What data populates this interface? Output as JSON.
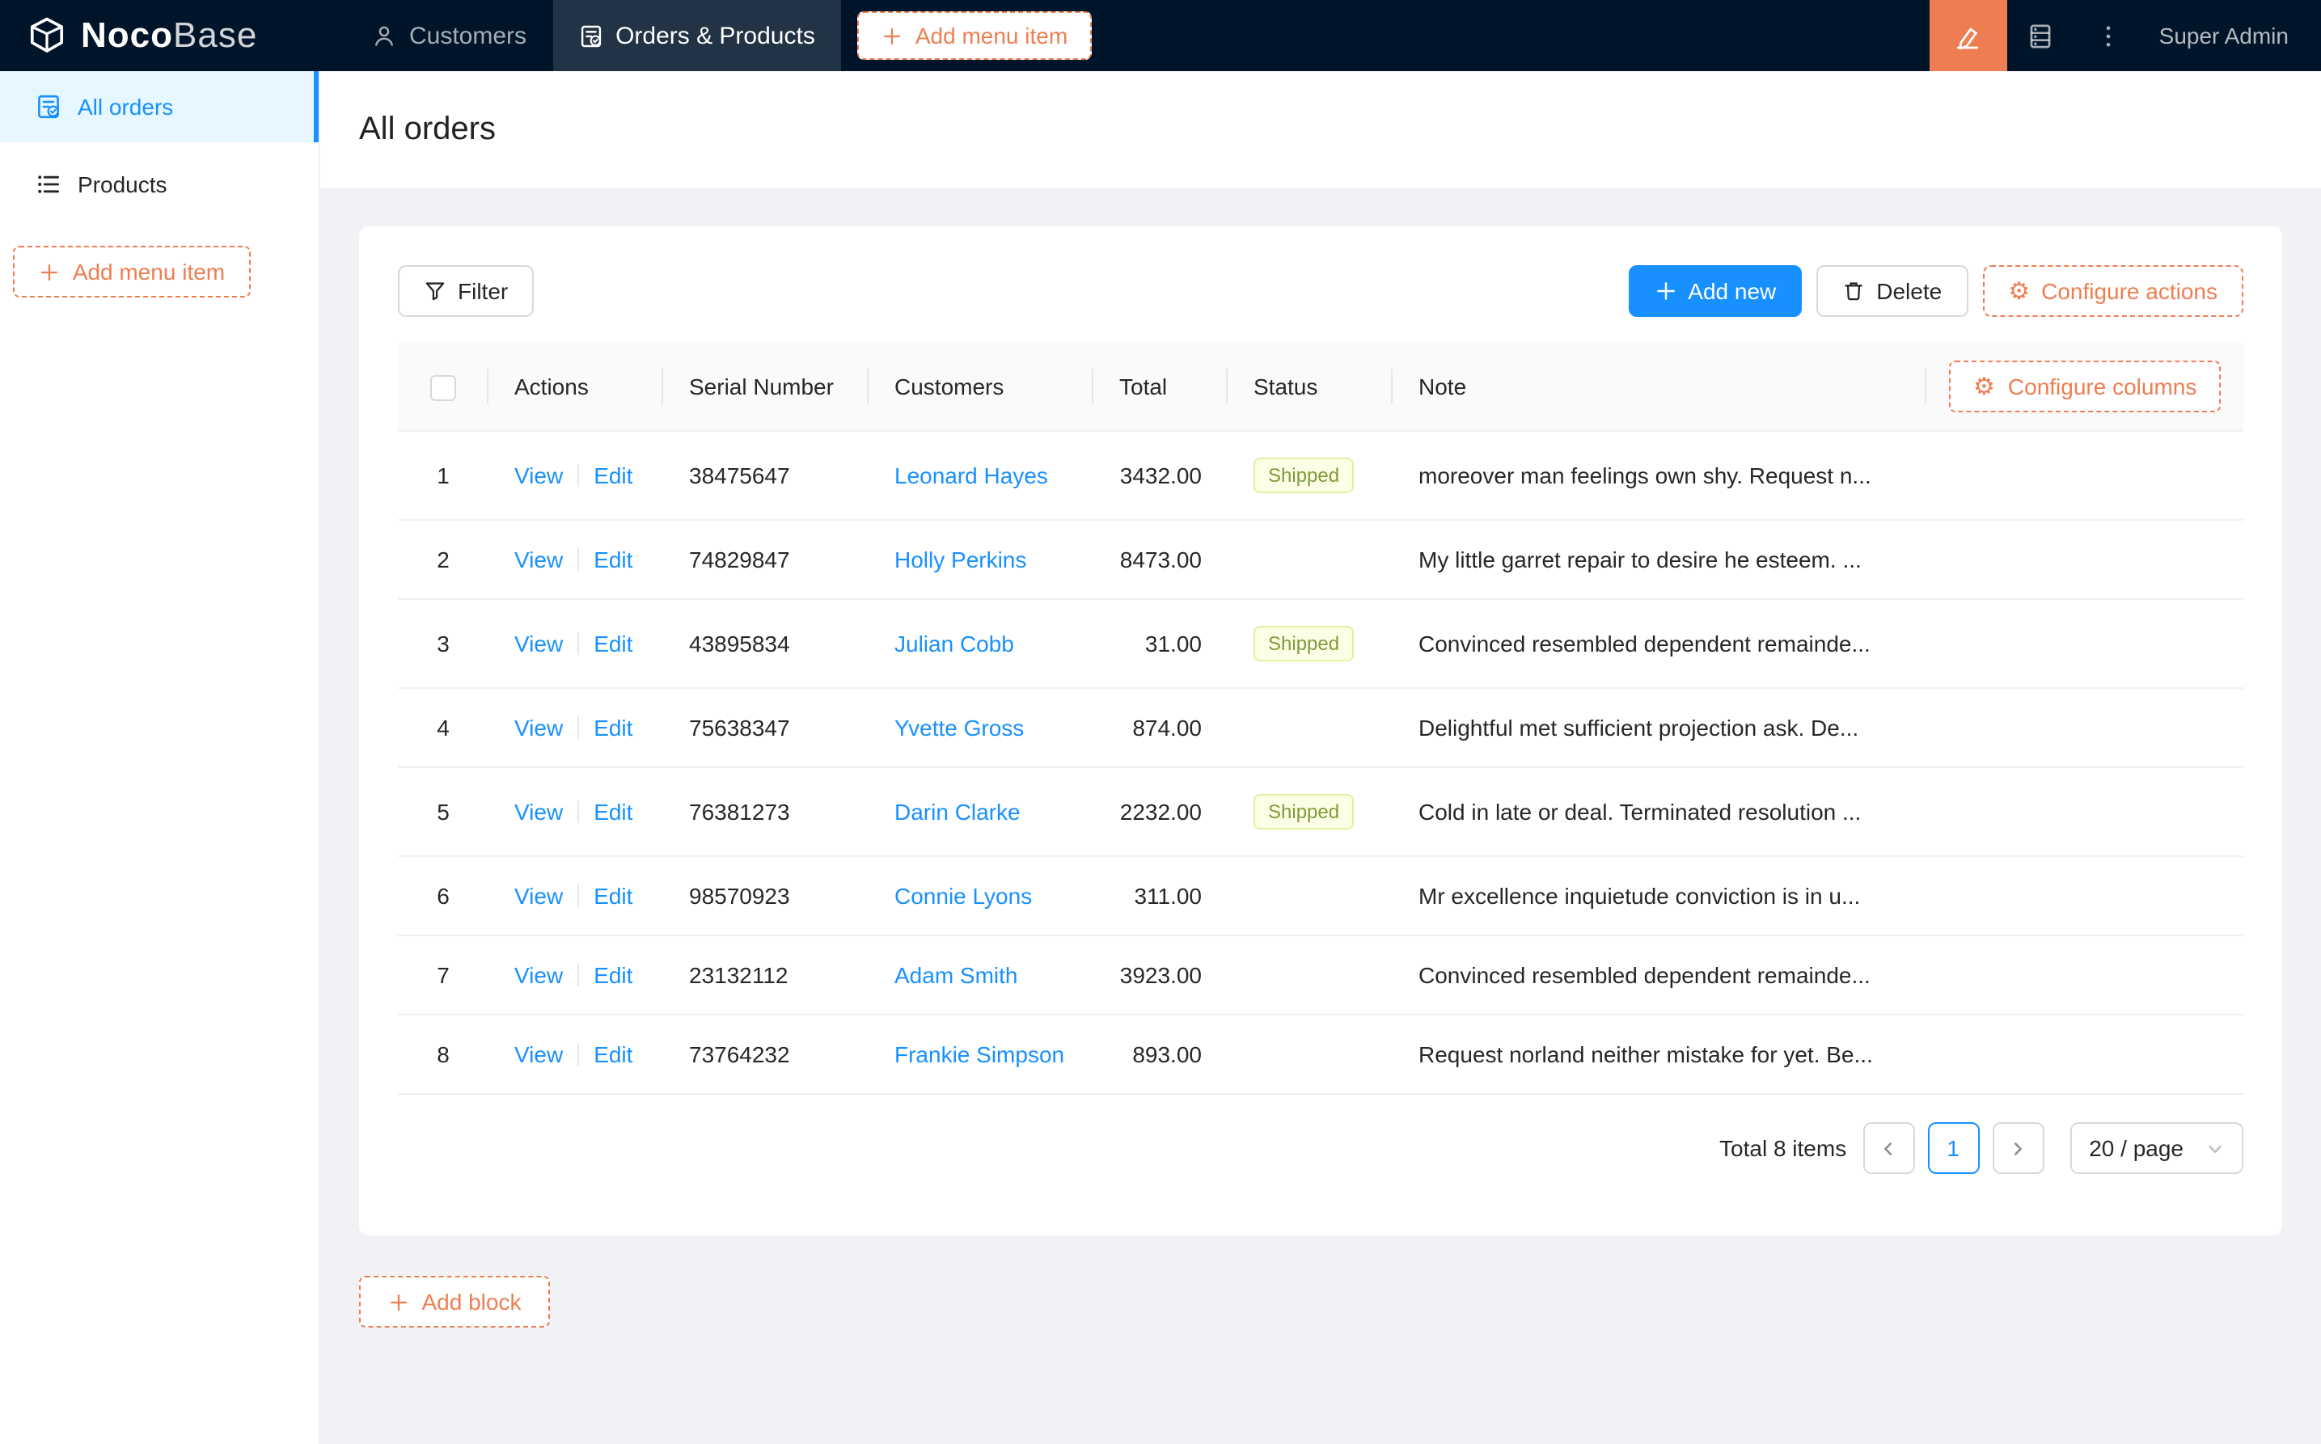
{
  "colors": {
    "accent_orange": "#ee7e51",
    "primary_blue": "#1890ff",
    "header_bg": "#001529",
    "sidebar_selected_bg": "#e6f7ff",
    "content_bg": "#f0f2f5",
    "tag_shipped_bg": "#fcffe6",
    "tag_shipped_border": "#e4ef9f",
    "tag_shipped_text": "#7f9a3a"
  },
  "icons": {
    "gear": "⚙"
  },
  "header": {
    "logo_primary": "Noco",
    "logo_secondary": "Base",
    "tabs": [
      {
        "label": "Customers"
      },
      {
        "label": "Orders & Products"
      }
    ],
    "add_menu_item_label": "Add menu item",
    "user": "Super Admin"
  },
  "sidebar": {
    "items": [
      {
        "label": "All orders"
      },
      {
        "label": "Products"
      }
    ],
    "add_menu_item_label": "Add menu item"
  },
  "page": {
    "title": "All orders"
  },
  "toolbar": {
    "filter_label": "Filter",
    "add_new_label": "Add new",
    "delete_label": "Delete",
    "configure_actions_label": "Configure actions"
  },
  "table": {
    "columns": [
      "Actions",
      "Serial Number",
      "Customers",
      "Total",
      "Status",
      "Note"
    ],
    "configure_columns_label": "Configure columns",
    "view_label": "View",
    "edit_label": "Edit",
    "rows": [
      {
        "index": "1",
        "serial": "38475647",
        "customer": "Leonard Hayes",
        "total": "3432.00",
        "status": "Shipped",
        "note": "moreover man feelings own shy. Request n..."
      },
      {
        "index": "2",
        "serial": "74829847",
        "customer": "Holly Perkins",
        "total": "8473.00",
        "status": "",
        "note": "My little garret repair to desire he esteem. ..."
      },
      {
        "index": "3",
        "serial": "43895834",
        "customer": "Julian Cobb",
        "total": "31.00",
        "status": "Shipped",
        "note": "Convinced resembled dependent remainde..."
      },
      {
        "index": "4",
        "serial": "75638347",
        "customer": "Yvette Gross",
        "total": "874.00",
        "status": "",
        "note": "Delightful met sufficient projection ask. De..."
      },
      {
        "index": "5",
        "serial": "76381273",
        "customer": "Darin Clarke",
        "total": "2232.00",
        "status": "Shipped",
        "note": "Cold in late or deal. Terminated resolution ..."
      },
      {
        "index": "6",
        "serial": "98570923",
        "customer": "Connie Lyons",
        "total": "311.00",
        "status": "",
        "note": "Mr excellence inquietude conviction is in u..."
      },
      {
        "index": "7",
        "serial": "23132112",
        "customer": "Adam Smith",
        "total": "3923.00",
        "status": "",
        "note": "Convinced resembled dependent remainde..."
      },
      {
        "index": "8",
        "serial": "73764232",
        "customer": "Frankie Simpson",
        "total": "893.00",
        "status": "",
        "note": "Request norland neither mistake for yet. Be..."
      }
    ]
  },
  "pagination": {
    "total_text": "Total 8 items",
    "current": "1",
    "page_size": "20 / page"
  },
  "add_block_label": "Add block"
}
